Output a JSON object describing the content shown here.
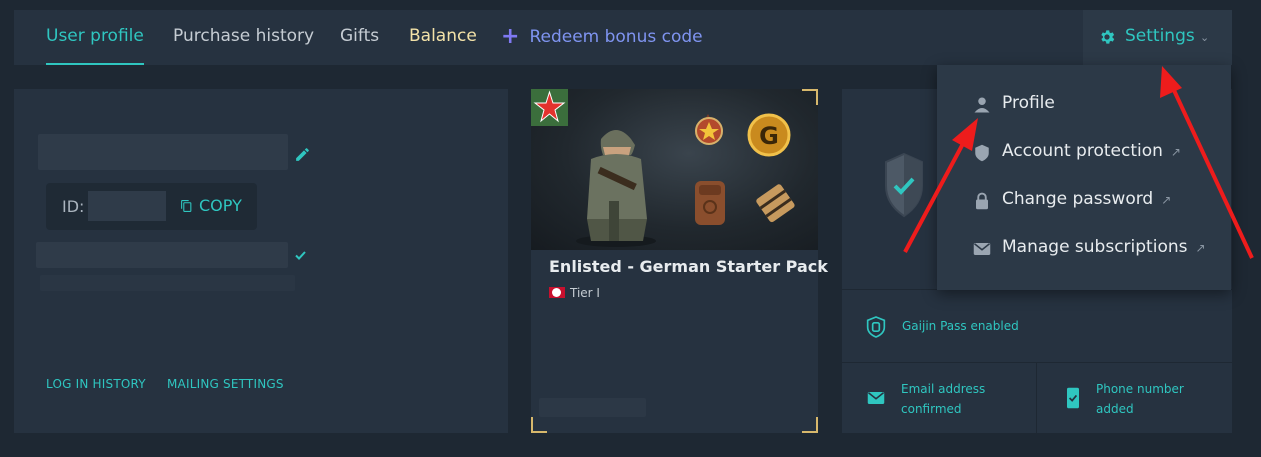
{
  "tabs": {
    "user_profile": "User profile",
    "purchase_history": "Purchase history",
    "gifts": "Gifts",
    "balance": "Balance",
    "redeem": "Redeem bonus code"
  },
  "settings": {
    "label": "Settings",
    "menu": {
      "profile": "Profile",
      "account_protection": "Account protection",
      "change_password": "Change password",
      "manage_subscriptions": "Manage subscriptions",
      "ext_mark": "↗"
    }
  },
  "profile": {
    "id_label": "ID:",
    "copy_label": "COPY",
    "log_in_history": "LOG IN HISTORY",
    "mailing_settings": "MAILING SETTINGS"
  },
  "product": {
    "title": "Enlisted - German Starter Pack",
    "tier": "Tier I"
  },
  "security": {
    "gaijin_pass": "Gaijin Pass enabled",
    "email_line1": "Email address",
    "email_line2": "confirmed",
    "phone_line1": "Phone number",
    "phone_line2": "added"
  },
  "colors": {
    "accent": "#2fc6c0",
    "balance": "#f3e2a8",
    "redeem": "#7f94f0",
    "annotation_arrow": "#ee1c1c"
  }
}
